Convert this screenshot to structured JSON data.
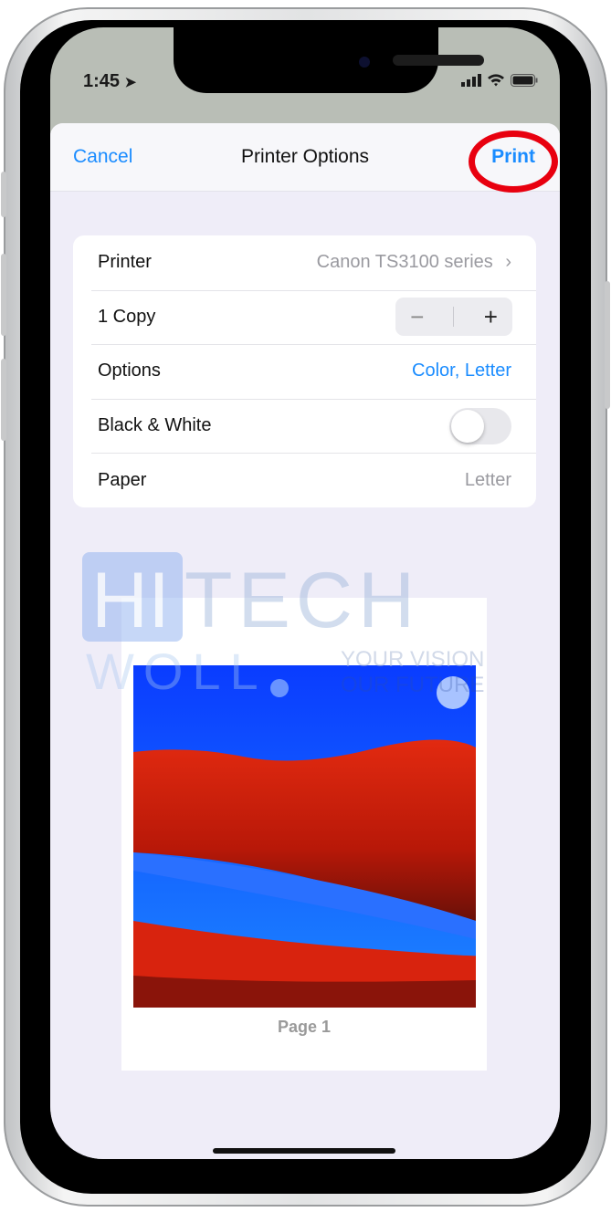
{
  "status_bar": {
    "time": "1:45",
    "icons": [
      "location-arrow-icon",
      "signal-icon",
      "wifi-icon",
      "battery-icon"
    ]
  },
  "nav": {
    "cancel": "Cancel",
    "title": "Printer Options",
    "print": "Print",
    "highlight_color": "#e8000f"
  },
  "options": {
    "printer": {
      "label": "Printer",
      "value": "Canon TS3100 series"
    },
    "copies": {
      "label": "1 Copy",
      "minus": "−",
      "plus": "+"
    },
    "options": {
      "label": "Options",
      "value": "Color, Letter"
    },
    "bw": {
      "label": "Black & White",
      "on": false
    },
    "paper": {
      "label": "Paper",
      "value": "Letter"
    }
  },
  "preview": {
    "page_label": "Page 1"
  },
  "watermark": {
    "text": "HITECH WOLL",
    "tagline": "YOUR VISION OUR FUTURE"
  },
  "colors": {
    "accent": "#1a8cff"
  }
}
